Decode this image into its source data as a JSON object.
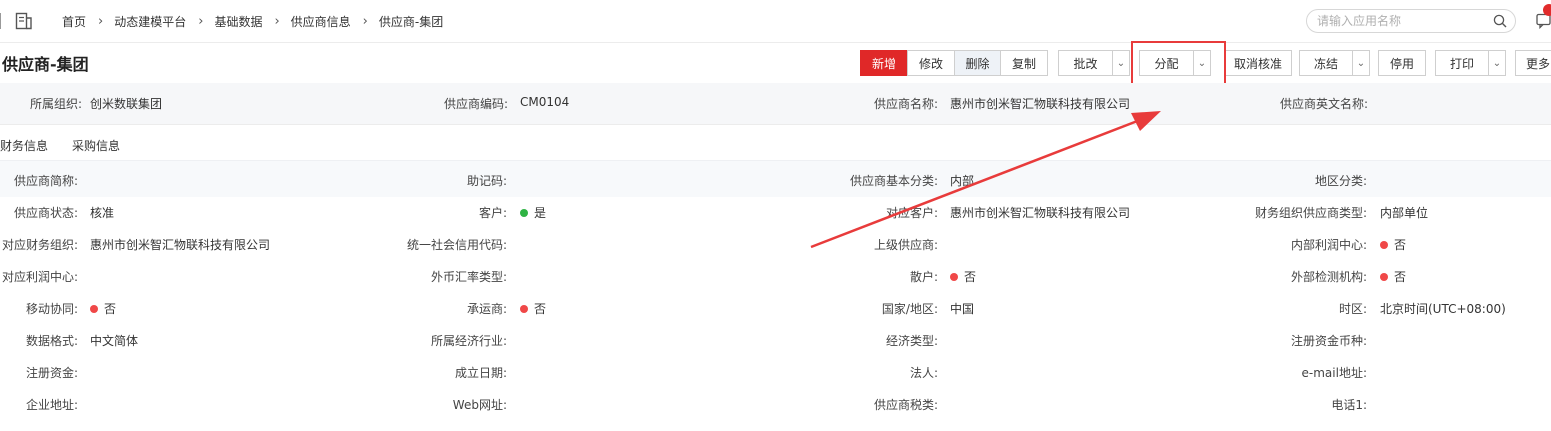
{
  "breadcrumb": [
    "首页",
    "动态建模平台",
    "基础数据",
    "供应商信息",
    "供应商-集团"
  ],
  "search": {
    "placeholder": "请输入应用名称"
  },
  "page": {
    "title": "供应商-集团"
  },
  "toolbar": {
    "add": "新增",
    "edit": "修改",
    "delete": "删除",
    "copy": "复制",
    "batch_edit": "批改",
    "assign": "分配",
    "cancel_approve": "取消核准",
    "freeze": "冻结",
    "disable": "停用",
    "print": "打印",
    "more": "更多"
  },
  "header_fields": [
    {
      "label": "所属组织:",
      "value": "创米数联集团"
    },
    {
      "label": "供应商编码:",
      "value": "CM0104"
    },
    {
      "label": "供应商名称:",
      "value": "惠州市创米智汇物联科技有限公司"
    },
    {
      "label": "供应商英文名称:",
      "value": ""
    }
  ],
  "tabs": [
    "财务信息",
    "采购信息"
  ],
  "fields": [
    [
      {
        "label": "供应商简称:",
        "value": ""
      },
      {
        "label": "助记码:",
        "value": ""
      },
      {
        "label": "供应商基本分类:",
        "value": "内部"
      },
      {
        "label": "地区分类:",
        "value": ""
      }
    ],
    [
      {
        "label": "供应商状态:",
        "value": "核准"
      },
      {
        "label": "客户:",
        "value": "是",
        "dot": "#2fb344"
      },
      {
        "label": "对应客户:",
        "value": "惠州市创米智汇物联科技有限公司"
      },
      {
        "label": "财务组织供应商类型:",
        "value": "内部单位"
      }
    ],
    [
      {
        "label": "对应财务组织:",
        "value": "惠州市创米智汇物联科技有限公司"
      },
      {
        "label": "统一社会信用代码:",
        "value": ""
      },
      {
        "label": "上级供应商:",
        "value": ""
      },
      {
        "label": "内部利润中心:",
        "value": "否",
        "dot": "#f04848"
      }
    ],
    [
      {
        "label": "对应利润中心:",
        "value": ""
      },
      {
        "label": "外币汇率类型:",
        "value": ""
      },
      {
        "label": "散户:",
        "value": "否",
        "dot": "#f04848"
      },
      {
        "label": "外部检测机构:",
        "value": "否",
        "dot": "#f04848"
      }
    ],
    [
      {
        "label": "移动协同:",
        "value": "否",
        "dot": "#f04848"
      },
      {
        "label": "承运商:",
        "value": "否",
        "dot": "#f04848"
      },
      {
        "label": "国家/地区:",
        "value": "中国"
      },
      {
        "label": "时区:",
        "value": "北京时间(UTC+08:00)"
      }
    ],
    [
      {
        "label": "数据格式:",
        "value": "中文简体"
      },
      {
        "label": "所属经济行业:",
        "value": ""
      },
      {
        "label": "经济类型:",
        "value": ""
      },
      {
        "label": "注册资金币种:",
        "value": ""
      }
    ],
    [
      {
        "label": "注册资金:",
        "value": ""
      },
      {
        "label": "成立日期:",
        "value": ""
      },
      {
        "label": "法人:",
        "value": ""
      },
      {
        "label": "e-mail地址:",
        "value": ""
      }
    ],
    [
      {
        "label": "企业地址:",
        "value": ""
      },
      {
        "label": "Web网址:",
        "value": ""
      },
      {
        "label": "供应商税类:",
        "value": ""
      },
      {
        "label": "电话1:",
        "value": ""
      }
    ]
  ],
  "colors": {
    "primary": "#e02828",
    "highlight": "#e83b3b",
    "yes": "#2fb344",
    "no": "#f04848"
  },
  "icons": [
    "document-icon",
    "chevron-right-icon",
    "search-icon",
    "message-icon",
    "chevron-down-icon",
    "arrow-annotation"
  ]
}
